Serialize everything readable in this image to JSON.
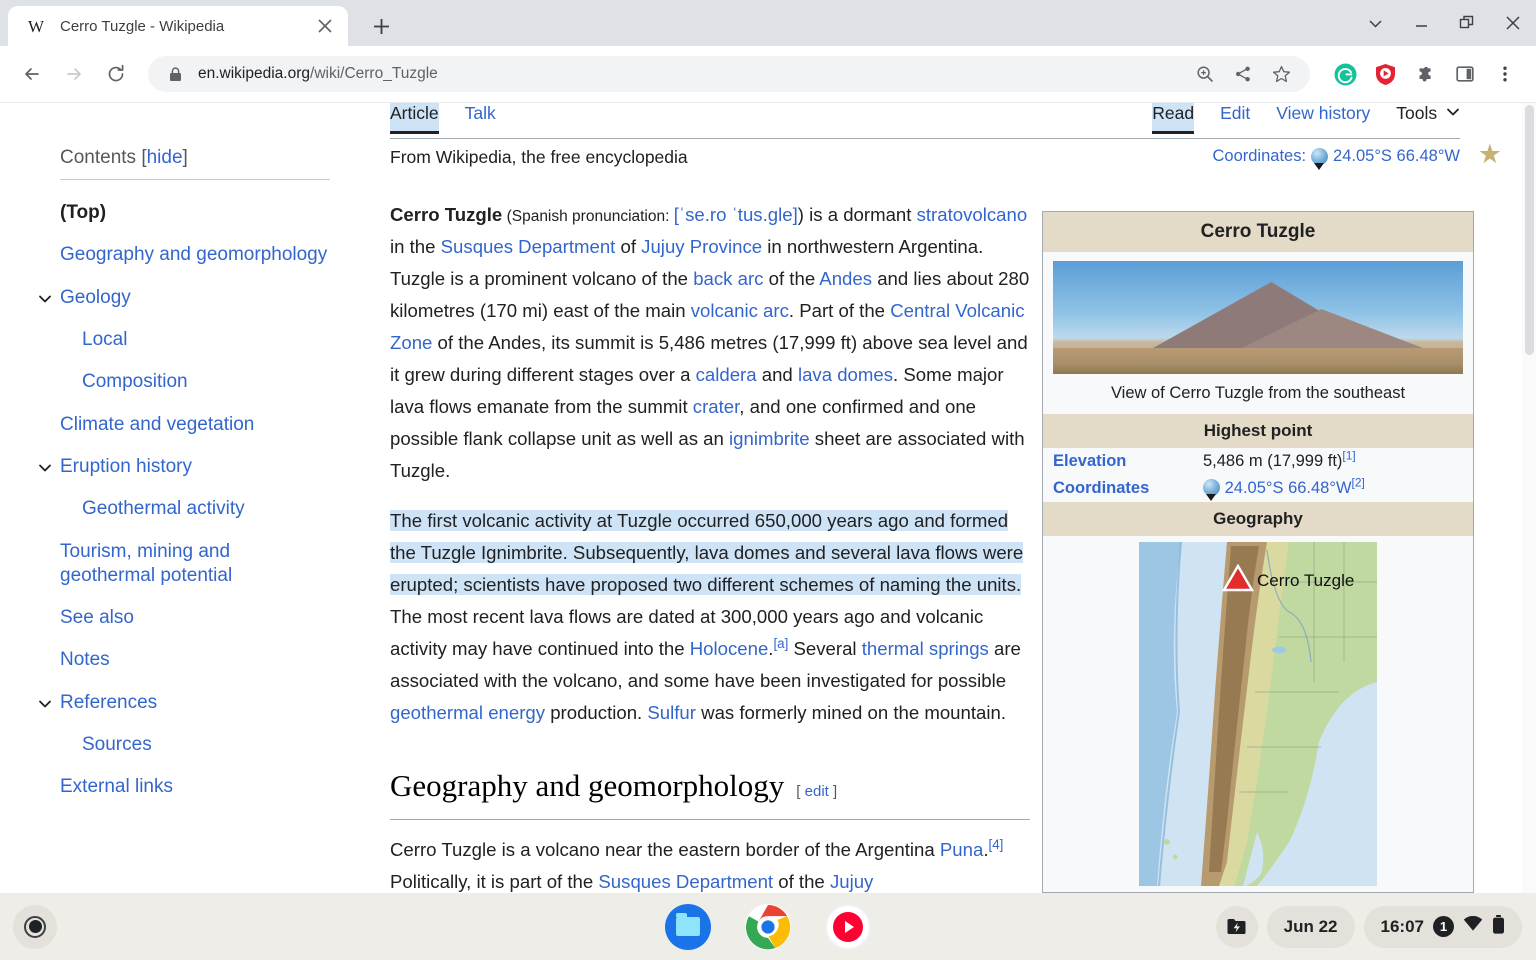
{
  "browser": {
    "tab": {
      "favicon": "wikipedia-w-icon",
      "title": "Cerro Tuzgle - Wikipedia",
      "close_label": "×"
    },
    "new_tab_label": "+",
    "window_controls": {
      "expand": "chevron-down-icon",
      "minimize": "minimize-icon",
      "maximize": "restore-icon",
      "close": "close-icon"
    },
    "toolbar": {
      "back": "back-arrow-icon",
      "forward": "forward-arrow-icon",
      "reload": "reload-icon",
      "lock": "lock-icon",
      "url_domain": "en.wikipedia.org",
      "url_path": "/wiki/Cerro_Tuzgle",
      "zoom": "zoom-in-icon",
      "share": "share-icon",
      "bookmark": "star-outline-icon",
      "grammarly": "grammarly-extension-icon",
      "adblock": "adblock-extension-icon",
      "extensions": "puzzle-piece-icon",
      "sidepanel": "side-panel-icon",
      "menu": "three-dot-menu-icon"
    }
  },
  "wiki": {
    "contents_label": "Contents",
    "hide_label": "hide",
    "toc": [
      {
        "label": "(Top)",
        "level": 1,
        "active": true,
        "chevron": false
      },
      {
        "label": "Geography and geomorphology",
        "level": 1,
        "active": false,
        "chevron": false
      },
      {
        "label": "Geology",
        "level": 1,
        "active": false,
        "chevron": true
      },
      {
        "label": "Local",
        "level": 2,
        "active": false,
        "chevron": false
      },
      {
        "label": "Composition",
        "level": 2,
        "active": false,
        "chevron": false
      },
      {
        "label": "Climate and vegetation",
        "level": 1,
        "active": false,
        "chevron": false
      },
      {
        "label": "Eruption history",
        "level": 1,
        "active": false,
        "chevron": true
      },
      {
        "label": "Geothermal activity",
        "level": 2,
        "active": false,
        "chevron": false
      },
      {
        "label": "Tourism, mining and geothermal potential",
        "level": 1,
        "active": false,
        "chevron": false
      },
      {
        "label": "See also",
        "level": 1,
        "active": false,
        "chevron": false
      },
      {
        "label": "Notes",
        "level": 1,
        "active": false,
        "chevron": false
      },
      {
        "label": "References",
        "level": 1,
        "active": false,
        "chevron": true
      },
      {
        "label": "Sources",
        "level": 2,
        "active": false,
        "chevron": false
      },
      {
        "label": "External links",
        "level": 1,
        "active": false,
        "chevron": false
      }
    ],
    "namespace_tabs": [
      {
        "label": "Article",
        "selected": true
      },
      {
        "label": "Talk",
        "selected": false
      }
    ],
    "view_tabs": [
      {
        "label": "Read",
        "selected": true
      },
      {
        "label": "Edit",
        "selected": false
      },
      {
        "label": "View history",
        "selected": false
      },
      {
        "label": "Tools",
        "selected": false,
        "chevron": true
      }
    ],
    "tagline": "From Wikipedia, the free encyclopedia",
    "coordinates_label": "Coordinates:",
    "coordinates_value": "24.05°S 66.48°W",
    "featured_star": "featured-article-star-icon",
    "article": {
      "title_bold": "Cerro Tuzgle",
      "pron_prefix": " (Spanish pronunciation: ",
      "pron_value": "[ˈse.ro ˈtus.ɡle]",
      "p1_a": ") is a dormant ",
      "p1_link1": "stratovolcano",
      "p1_b": " in the ",
      "p1_link2": "Susques Department",
      "p1_c": " of ",
      "p1_link3": "Jujuy Province",
      "p1_d": " in northwestern Argentina. Tuzgle is a prominent volcano of the ",
      "p1_link4": "back arc",
      "p1_e": " of the ",
      "p1_link5": "Andes",
      "p1_f": " and lies about 280 kilometres (170 mi) east of the main ",
      "p1_link6": "volcanic arc",
      "p1_g": ". Part of the ",
      "p1_link7": "Central Volcanic Zone",
      "p1_h": " of the Andes, its summit is 5,486 metres (17,999 ft) above sea level and it grew during different stages over a ",
      "p1_link8": "caldera",
      "p1_i": " and ",
      "p1_link9": "lava domes",
      "p1_j": ". Some major lava flows emanate from the summit ",
      "p1_link10": "crater",
      "p1_k": ", and one confirmed and one possible flank collapse unit as well as an ",
      "p1_link11": "ignimbrite",
      "p1_l": " sheet are associated with Tuzgle.",
      "p2_sel": "The first volcanic activity at Tuzgle occurred 650,000 years ago and formed the Tuzgle Ignimbrite. Subsequently, lava domes and several lava flows were erupted; scientists have proposed two different schemes of naming the units.",
      "p2_a": " The most recent lava flows are dated at 300,000 years ago and volcanic activity may have continued into the ",
      "p2_link1": "Holocene",
      "p2_b": ".",
      "p2_note": "[a]",
      "p2_c": " Several ",
      "p2_link2": "thermal springs",
      "p2_d": " are associated with the volcano, and some have been investigated for possible ",
      "p2_link3": "geothermal energy",
      "p2_e": " production. ",
      "p2_link4": "Sulfur",
      "p2_f": " was formerly mined on the mountain.",
      "h2_geography": "Geography and geomorphology",
      "edit_open": "[",
      "edit_label": "edit",
      "edit_close": "]",
      "p3_a": "Cerro Tuzgle is a volcano near the eastern border of the Argentina ",
      "p3_link1": "Puna",
      "p3_b": ".",
      "p3_ref": "[4]",
      "p3_c": " Politically, it is part of the ",
      "p3_link2": "Susques Department",
      "p3_d": " of the ",
      "p3_link3": "Jujuy"
    },
    "infobox": {
      "title": "Cerro Tuzgle",
      "photo_alt": "photo-of-cerro-tuzgle",
      "caption": "View of Cerro Tuzgle from the southeast",
      "section_highest": "Highest point",
      "elevation_key": "Elevation",
      "elevation_value": "5,486 m (17,999 ft)",
      "elevation_ref": "[1]",
      "coordinates_key": "Coordinates",
      "coordinates_value": "24.05°S 66.48°W",
      "coordinates_ref": "[2]",
      "section_geography": "Geography",
      "map_label": "Cerro Tuzgle",
      "map_alt": "relief-map-of-argentina"
    }
  },
  "shelf": {
    "launcher": "launcher-icon",
    "apps": [
      {
        "name": "files-app-icon",
        "label": "Files",
        "active": false
      },
      {
        "name": "chrome-app-icon",
        "label": "Chrome",
        "active": true
      },
      {
        "name": "youtube-music-app-icon",
        "label": "YouTube Music",
        "active": false
      }
    ],
    "tray": {
      "screen_capture": "screen-capture-icon",
      "date": "Jun 22",
      "time": "16:07",
      "notification_count": "1",
      "wifi": "wifi-icon",
      "battery": "battery-icon"
    }
  },
  "colors": {
    "link": "#3366cc",
    "selection": "#cfe3f7",
    "infobox_header": "#e3dbc7",
    "chrome_tabstrip": "#DEE1E6",
    "shelf": "#EFEDE8"
  }
}
